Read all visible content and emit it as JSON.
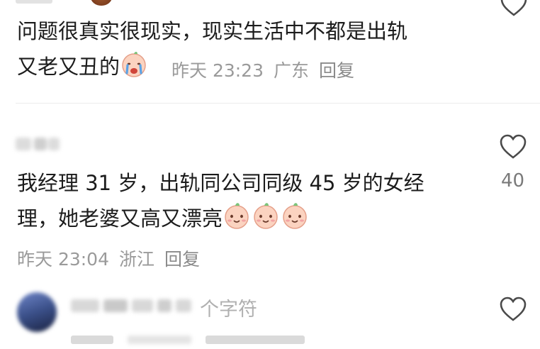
{
  "top_comment": {
    "text_line1": "问题很真实很现实，现实生活中不都是出轨",
    "text_line2": "又老又丑的",
    "emoji": "crying-face",
    "time": "昨天 23:23",
    "location": "广东",
    "reply_label": "回复"
  },
  "main_comment": {
    "text_line1": "我经理 31 岁，出轨同公司同级 45 岁的女经",
    "text_line2": "理，她老婆又高又漂亮",
    "emojis": [
      "smiling-face",
      "smiling-face",
      "smiling-face"
    ],
    "time": "昨天 23:04",
    "location": "浙江",
    "reply_label": "回复",
    "like_count": "40"
  },
  "next_comment": {
    "hint": "个字符"
  },
  "colors": {
    "text": "#1c1c1c",
    "meta": "#9a9a9a",
    "divider": "#ececec"
  }
}
